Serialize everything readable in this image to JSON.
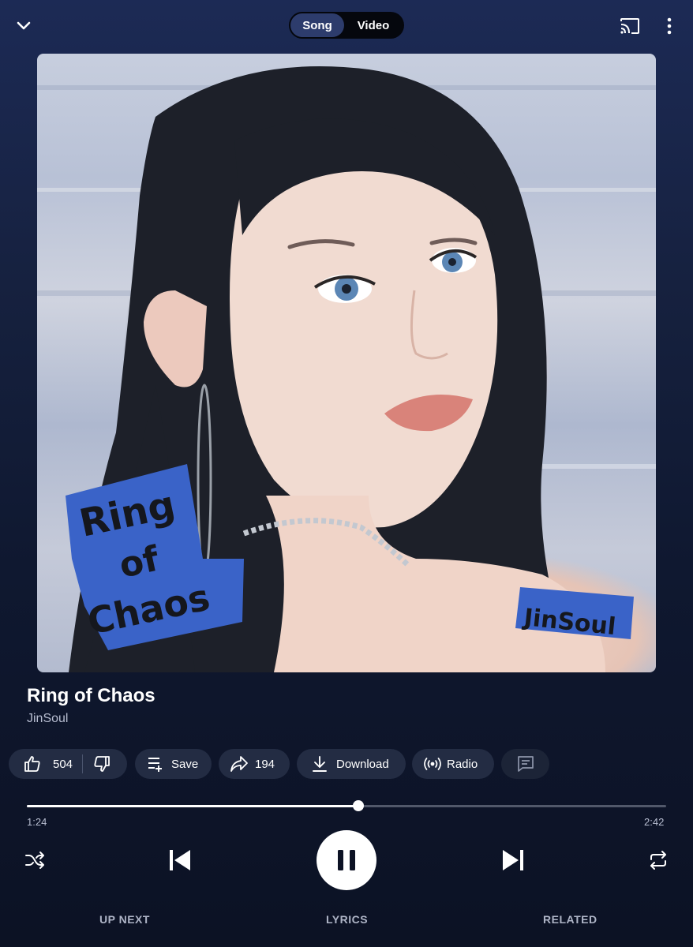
{
  "header": {
    "toggle_options": [
      "Song",
      "Video"
    ],
    "selected_option": "Song",
    "icons": [
      "chevron-down-icon",
      "cast-icon",
      "more-vert-icon"
    ]
  },
  "artwork": {
    "sticker_title": "Ring of Chaos",
    "sticker_artist": "JinSoul"
  },
  "track": {
    "title": "Ring of Chaos",
    "artist": "JinSoul"
  },
  "actions": {
    "like_count": "504",
    "save_label": "Save",
    "share_count": "194",
    "download_label": "Download",
    "radio_label": "Radio"
  },
  "playback": {
    "current_time": "1:24",
    "total_time": "2:42",
    "progress": 0.519,
    "state": "playing"
  },
  "bottom_tabs": {
    "up_next": "UP NEXT",
    "lyrics": "LYRICS",
    "related": "RELATED"
  },
  "colors": {
    "background_top": "#1c2a55",
    "background_bottom": "#0c1224",
    "pill_bg": "#232c43",
    "selected_toggle": "#2d3c6c",
    "sticker_blue": "#3a63c8"
  }
}
